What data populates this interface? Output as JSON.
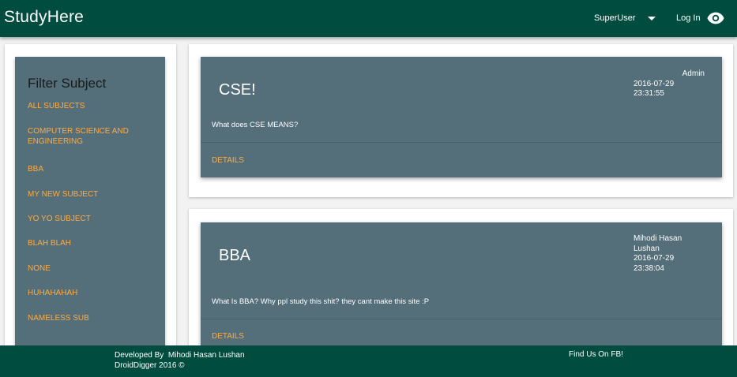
{
  "header": {
    "brand": "StudyHere",
    "user_menu": "SuperUser",
    "login": "Log In"
  },
  "sidebar": {
    "title": "Filter Subject",
    "subjects": [
      "ALL SUBJECTS",
      "COMPUTER SCIENCE AND ENGINEERING",
      "BBA",
      "MY NEW SUBJECT",
      "YO YO SUBJECT",
      "BLAH BLAH",
      "NONE",
      "HUHAHAHAH",
      "NAMELESS SUB"
    ]
  },
  "posts": [
    {
      "title": "CSE!",
      "author": "Admin",
      "date": "2016-07-29",
      "time": "23:31:55",
      "body": "What does CSE MEANS?",
      "action": "DETAILS"
    },
    {
      "title": "BBA",
      "author_line1": "Mihodi Hasan",
      "author_line2": "Lushan",
      "date": "2016-07-29",
      "time": "23:38:04",
      "body": "What Is BBA? Why ppl study this shit? they cant make this site :P",
      "action": "DETAILS"
    }
  ],
  "footer": {
    "developed_by": "Developed By  Mihodi Hasan Lushan",
    "copyright": "DroidDigger 2016 ©",
    "fb_link": "Find Us On FB!"
  },
  "colors": {
    "header": "#004d40",
    "card": "#546e7a",
    "accent": "#ffab40"
  }
}
